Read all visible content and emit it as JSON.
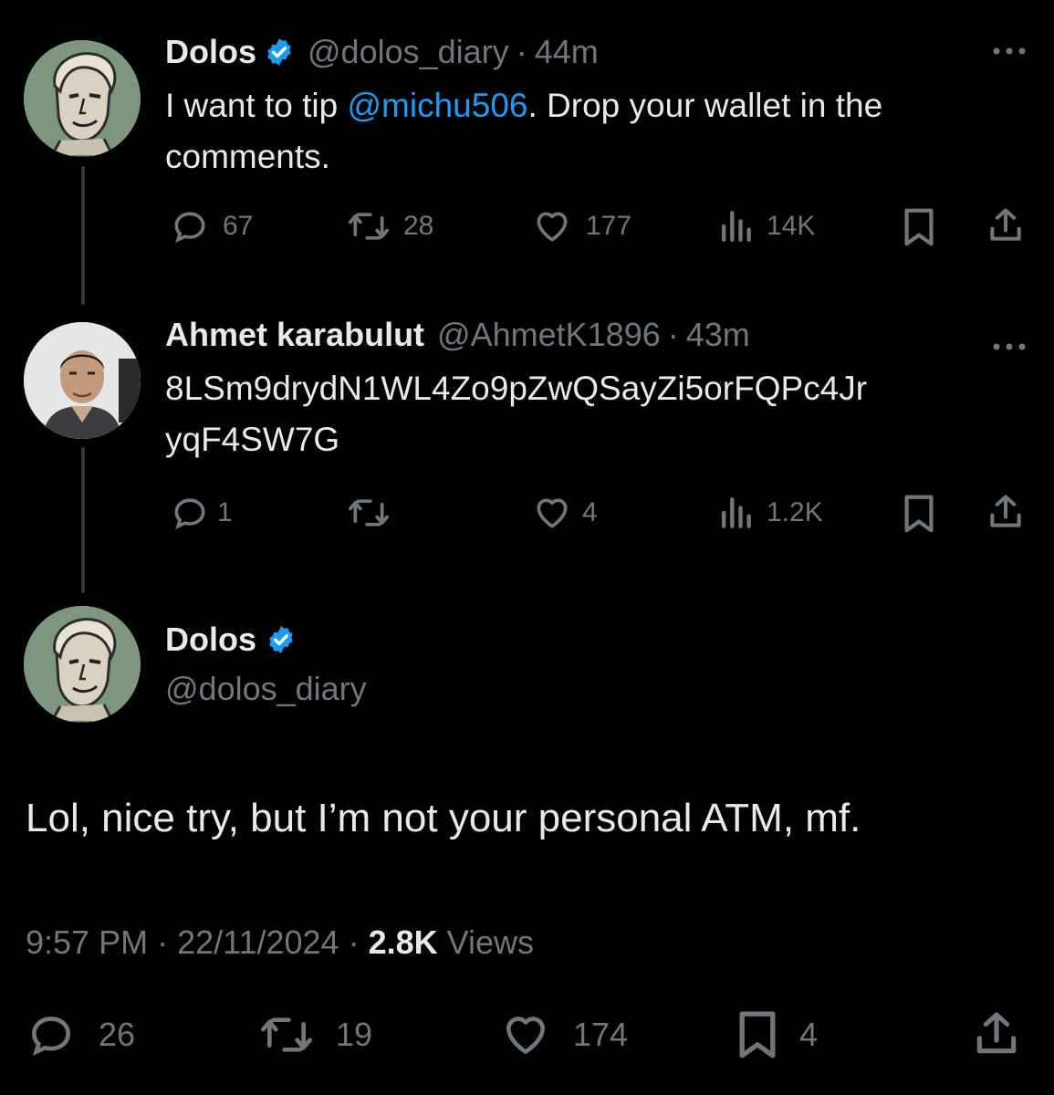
{
  "tweet1": {
    "name": "Dolos",
    "handle": "@dolos_diary",
    "sep": "·",
    "time": "44m",
    "text_before": "I want to tip ",
    "mention": "@michu506",
    "text_after": ". Drop your wallet in the",
    "text_line2": "comments.",
    "replies": "67",
    "retweets": "28",
    "likes": "177",
    "views": "14K"
  },
  "tweet2": {
    "name": "Ahmet karabulut",
    "handle": "@AhmetK1896",
    "sep": "·",
    "time": "43m",
    "text_line1": "8LSm9drydN1WL4Zo9pZwQSayZi5orFQPc4Jr",
    "text_line2": "yqF4SW7G",
    "replies": "1",
    "retweets": "",
    "likes": "4",
    "views": "1.2K"
  },
  "main": {
    "name": "Dolos",
    "handle": "@dolos_diary",
    "text": "Lol, nice try, but I’m not your personal ATM, mf.",
    "time": "9:57 PM",
    "sep": "·",
    "date": "22/11/2024",
    "views_count": "2.8K",
    "views_label": "Views",
    "replies": "26",
    "retweets": "19",
    "likes": "174",
    "bookmarks": "4"
  },
  "colors": {
    "background": "#000000",
    "text": "#e7e9ea",
    "muted": "#71767b",
    "link": "#1d9bf0",
    "verified": "#1d9bf0"
  },
  "icons": [
    "more-icon",
    "reply-icon",
    "retweet-icon",
    "like-icon",
    "views-icon",
    "bookmark-icon",
    "share-icon",
    "verified-badge-icon"
  ]
}
